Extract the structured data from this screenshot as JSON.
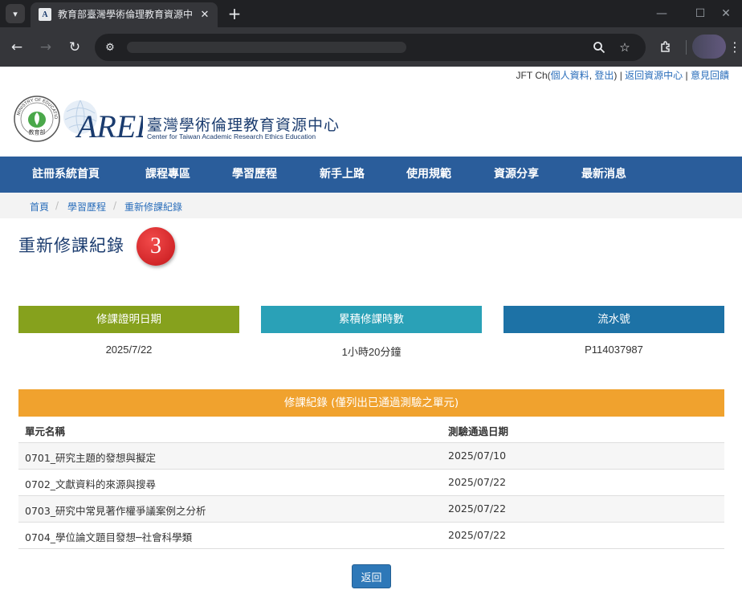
{
  "browser": {
    "tab_title": "教育部臺灣學術倫理教育資源中心",
    "tab_close": "✕",
    "new_tab": "+",
    "window_controls": {
      "minimize": "—",
      "maximize": "☐",
      "close": "✕"
    },
    "icons": [
      "tab-list-icon",
      "back-arrow-icon",
      "forward-arrow-icon",
      "reload-icon",
      "site-info-icon",
      "zoom-icon",
      "bookmark-star-icon",
      "extensions-icon",
      "profile-avatar",
      "more-menu-icon"
    ]
  },
  "user_bar": {
    "user_name": "JFT Ch(",
    "profile_link": "個人資料",
    "comma": ", ",
    "logout_link": "登出",
    "close_paren": ")",
    "sep1": " | ",
    "resource_center_link": "返回資源中心",
    "sep2": " | ",
    "feedback_link": "意見回饋"
  },
  "logo": {
    "title": "臺灣學術倫理教育資源中心",
    "subtitle": "Center for Taiwan Academic Research Ethics Education",
    "wordmark": "AREE",
    "moe_text": "MINISTRY OF EDUCATION",
    "moe_label": "教育部"
  },
  "nav": {
    "items": [
      "註冊系統首頁",
      "課程專區",
      "學習歷程",
      "新手上路",
      "使用規範",
      "資源分享",
      "最新消息"
    ]
  },
  "breadcrumb": {
    "items": [
      "首頁",
      "學習歷程",
      "重新修課紀錄"
    ],
    "separator": "/"
  },
  "page": {
    "title": "重新修課紀錄",
    "step_badge": "3"
  },
  "summary": {
    "cert_date_label": "修課證明日期",
    "cert_date_value": "2025/7/22",
    "total_hours_label": "累積修課時數",
    "total_hours_value": "1小時20分鐘",
    "serial_label": "流水號",
    "serial_value": "P114037987"
  },
  "records": {
    "title": "修課紀錄 (僅列出已通過測驗之單元)",
    "columns": [
      "單元名稱",
      "測驗通過日期"
    ],
    "rows": [
      {
        "unit": "0701_研究主題的發想與擬定",
        "date": "2025/07/10"
      },
      {
        "unit": "0702_文獻資料的來源與搜尋",
        "date": "2025/07/22"
      },
      {
        "unit": "0703_研究中常見著作權爭議案例之分析",
        "date": "2025/07/22"
      },
      {
        "unit": "0704_學位論文題目發想─社會科學類",
        "date": "2025/07/22"
      }
    ]
  },
  "back_button": "返回",
  "colors": {
    "nav_bg": "#2a5d9b",
    "cert_date_head": "#86a11d",
    "total_hours_head": "#2aa1b7",
    "serial_head": "#1d72a6",
    "records_head": "#f0a22e",
    "title_text": "#1a3b6e",
    "badge_red": "#d7191d"
  }
}
